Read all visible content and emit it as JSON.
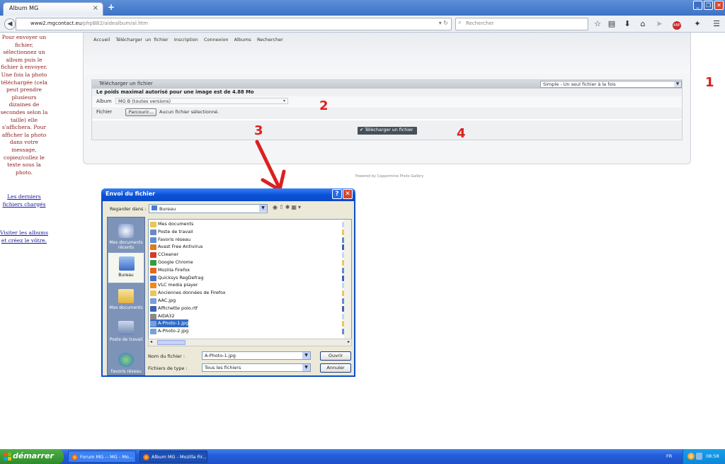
{
  "browser": {
    "tab_title": "Album MG",
    "tab_close": "×",
    "new_tab": "+",
    "url_domain": "www2.mgcontact.eu",
    "url_path": "/phpBB2/aidealbum/al.htm",
    "search_placeholder": "Rechercher",
    "window_buttons": [
      "_",
      "❐",
      "✕"
    ],
    "toolbar_icons": [
      "star-icon",
      "reading-list-icon",
      "download-icon",
      "home-icon",
      "send-icon",
      "abp-icon",
      "puzzle-icon",
      "menu-icon"
    ]
  },
  "sidebar": {
    "intro": "Pour envoyer un fichier, sélectionnez un album puis le fichier à envoyer. Une fois la photo téléchargée (cela peut prendre plusieurs dizaines de secondes selon la taille) elle s'affichera. Pour afficher la photo dans votre message, copiez/collez le texte sous la photo.",
    "link_recent": "Les derniers fichiers chargés",
    "link_albums": "Visiter les albums et créez le vôtre."
  },
  "gallery": {
    "nav": [
      "Accueil",
      "Télécharger un fichier",
      "Inscription",
      "Connexion",
      "Albums",
      "Rechercher"
    ],
    "form_title": "Télécharger un fichier",
    "mode_value": "Simple - Un seul fichier à la fois",
    "max_size": "Le poids maximal autorisé pour une image est de 4.88 Mo",
    "album_label": "Album",
    "album_value": "MG B (toutes versions)",
    "file_label": "Fichier",
    "browse_label": "Parcourir...",
    "no_file": "Aucun fichier sélectionné.",
    "upload_label": "✔ Télécharger un fichier",
    "powered": "Powered by Coppermine Photo Gallery"
  },
  "annotations": [
    "1",
    "2",
    "3",
    "4"
  ],
  "dialog": {
    "title": "Envoi du fichier",
    "help": "?",
    "close": "✕",
    "lookin_label": "Regarder dans :",
    "lookin_value": "Bureau",
    "places": [
      "Mes documents récents",
      "Bureau",
      "Mes documents",
      "Poste de travail",
      "Favoris réseau"
    ],
    "files": [
      {
        "name": "Mes documents",
        "color": "#e9c75a"
      },
      {
        "name": "Poste de travail",
        "color": "#6d89c4"
      },
      {
        "name": "Favoris réseau",
        "color": "#5f8fd0"
      },
      {
        "name": "Avast Free Antivirus",
        "color": "#e07a1f"
      },
      {
        "name": "CCleaner",
        "color": "#d33b2c"
      },
      {
        "name": "Google Chrome",
        "color": "#3a9a41"
      },
      {
        "name": "Mozilla Firefox",
        "color": "#e4661e"
      },
      {
        "name": "Quicksys RegDefrag",
        "color": "#4a6fc2"
      },
      {
        "name": "VLC media player",
        "color": "#f08a1c"
      },
      {
        "name": "Anciennes données de Firefox",
        "color": "#e9c75a"
      },
      {
        "name": "AAC.jpg",
        "color": "#7aa0d8"
      },
      {
        "name": "Affichette polo.rtf",
        "color": "#3c62b3"
      },
      {
        "name": "AIDA32",
        "color": "#8a8a8a"
      },
      {
        "name": "A-Photo-1.jpg",
        "color": "#7aa0d8"
      },
      {
        "name": "A-Photo-2.jpg",
        "color": "#7aa0d8"
      }
    ],
    "selected_index": 13,
    "files_col2": [
      "Cer",
      "Cha",
      "Chr",
      "Chr",
      "Clea",
      "Dee",
      "dist",
      "Doc",
      "eDr",
      "éne",
      "Ext",
      "F-A",
      "fax",
      "Fre",
      "Gen"
    ],
    "filename_label": "Nom du fichier :",
    "filename_value": "A-Photo-1.jpg",
    "filetype_label": "Fichiers de type :",
    "filetype_value": "Tous les fichiers",
    "open_label": "Ouvrir",
    "cancel_label": "Annuler"
  },
  "taskbar": {
    "start_label": "démarrer",
    "items": [
      "Forum MG -- MG - Mo...",
      "Album MG - Mozilla Fir..."
    ],
    "lang": "FR",
    "clock": "08:58"
  }
}
